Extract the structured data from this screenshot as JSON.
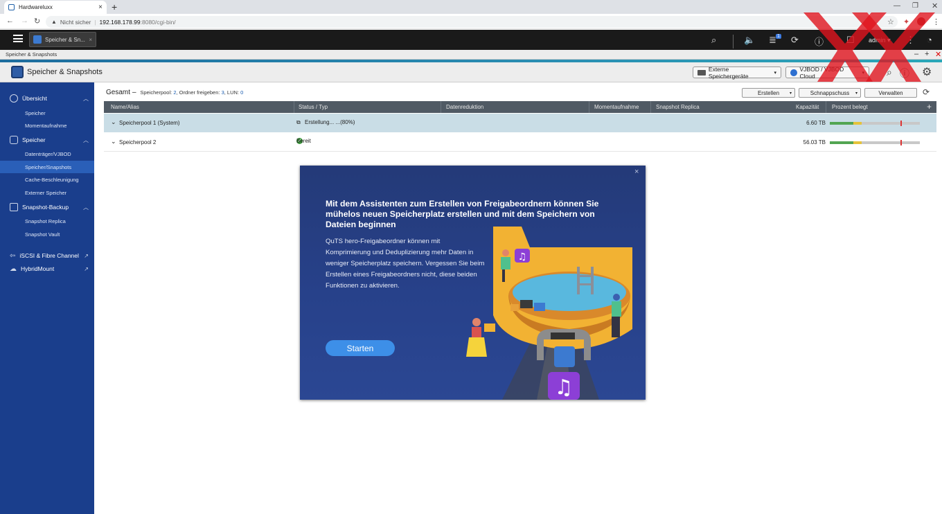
{
  "browser": {
    "tab_title": "Hardwareluxx",
    "new_tab_symbol": "+",
    "security_label": "Nicht sicher",
    "url_host": "192.168.178.99",
    "url_path": ":8080/cgi-bin/"
  },
  "qts": {
    "app_tab_label": "Speicher & Sn...",
    "notification_count": "1",
    "user": "admin"
  },
  "app": {
    "strip_title": "Speicher & Snapshots",
    "title": "Speicher & Snapshots",
    "header_buttons": {
      "external": "Externe Speichergeräte",
      "vjbod": "VJBOD / VJBOD Cloud"
    }
  },
  "sidebar": {
    "overview": "Übersicht",
    "overview_items": [
      "Speicher",
      "Momentaufnahme"
    ],
    "storage": "Speicher",
    "storage_items": [
      "Datenträger/VJBOD",
      "Speicher/Snapshots",
      "Cache-Beschleunigung",
      "Externer Speicher"
    ],
    "snapshot_backup": "Snapshot-Backup",
    "snapshot_items": [
      "Snapshot Replica",
      "Snapshot Vault"
    ],
    "iscsi": "iSCSI & Fibre Channel",
    "hybridmount": "HybridMount"
  },
  "summary": {
    "title": "Gesamt",
    "pool_label": "Speicherpool:",
    "pool_count": "2",
    "shares_label": "Ordner freigeben:",
    "shares_count": "3",
    "lun_label": "LUN:",
    "lun_count": "0"
  },
  "toolbar": {
    "create": "Erstellen",
    "snapshot": "Schnappschuss",
    "manage": "Verwalten"
  },
  "table": {
    "columns": [
      "Name/Alias",
      "Status / Typ",
      "Datenreduktion",
      "Momentaufnahme",
      "Snapshot Replica",
      "Kapazität",
      "Prozent belegt"
    ],
    "rows": [
      {
        "name": "Speicherpool 1 (System)",
        "status": "Erstellung... ...(80%)",
        "capacity": "6.60 TB",
        "used": 0.35
      },
      {
        "name": "Speicherpool 2",
        "status": "Bereit",
        "capacity": "56.03 TB",
        "used": 0.35
      }
    ]
  },
  "modal": {
    "heading": "Mit dem Assistenten zum Erstellen von Freigabeordnern können Sie mühelos neuen Speicherplatz erstellen und mit dem Speichern von Dateien beginnen",
    "body": "QuTS hero-Freigabeordner können mit Komprimierung und Deduplizierung mehr Daten in weniger Speicherplatz speichern. Vergessen Sie beim Erstellen eines Freigabeordners nicht, diese beiden Funktionen zu aktivieren.",
    "start_button": "Starten"
  },
  "colors": {
    "sidebar": "#1a3e8c",
    "modal": "#27418a",
    "accent": "#3d8fe8",
    "watermark": "#e0141e"
  }
}
